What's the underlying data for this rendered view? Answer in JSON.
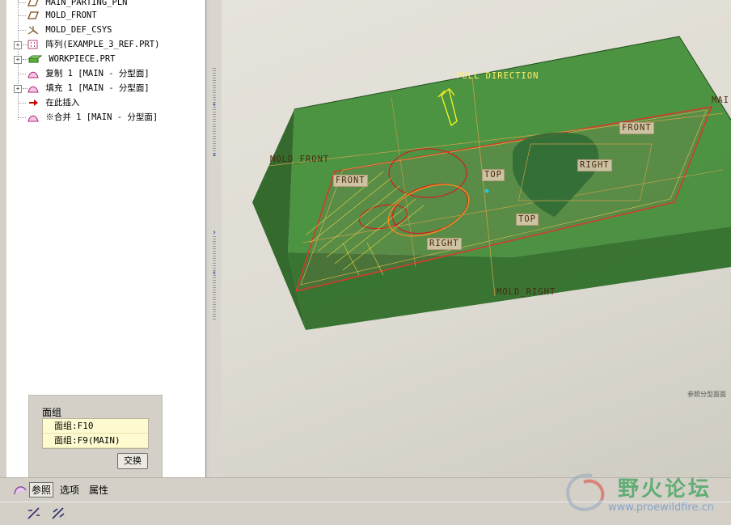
{
  "model_tree": {
    "items": [
      {
        "label": "MAIN_PARTING_PLN",
        "icon": "datum-plane-icon",
        "expander": false
      },
      {
        "label": "MOLD_FRONT",
        "icon": "datum-plane-icon",
        "expander": false
      },
      {
        "label": "MOLD_DEF_CSYS",
        "icon": "csys-icon",
        "expander": false
      },
      {
        "label": "阵列(EXAMPLE_3_REF.PRT)",
        "icon": "pattern-icon",
        "expander": true
      },
      {
        "label": "WORKPIECE.PRT",
        "icon": "workpiece-icon",
        "expander": true
      },
      {
        "label": "复制 1 [MAIN - 分型面]",
        "icon": "surface-icon",
        "expander": false
      },
      {
        "label": "填充 1 [MAIN - 分型面]",
        "icon": "surface-icon",
        "expander": true
      },
      {
        "label": "在此插入",
        "icon": "insert-here-arrow-icon",
        "expander": false
      },
      {
        "label": "※合并 1 [MAIN - 分型面]",
        "icon": "surface-icon",
        "expander": false
      }
    ]
  },
  "viewport": {
    "labels": {
      "pull_direction": "PULL DIRECTION",
      "main": "MAI",
      "front_right": "FRONT",
      "mold_front": "MOLD_FRONT",
      "front_left": "FRONT",
      "top_center": "TOP",
      "right_upper": "RIGHT",
      "top_lower": "TOP",
      "right_lower": "RIGHT",
      "mold_right": "MOLD_RIGHT"
    },
    "note": "参照分型面面",
    "colors": {
      "workpiece": "#2f7d2a",
      "parting_outline": "#d23c2c",
      "datum": "#c8a24a"
    }
  },
  "quilt_panel": {
    "title": "面组",
    "items": [
      "面组:F10",
      "面组:F9(MAIN)"
    ],
    "swap_label": "交换"
  },
  "tabs": [
    {
      "label": "参照",
      "active": true
    },
    {
      "label": "选项",
      "active": false
    },
    {
      "label": "属性",
      "active": false
    }
  ],
  "status_icons": [
    "merge-direction-icon",
    "merge-flip-icon"
  ],
  "watermark": {
    "title": "野火论坛",
    "url": "www.proewildfire.cn"
  }
}
